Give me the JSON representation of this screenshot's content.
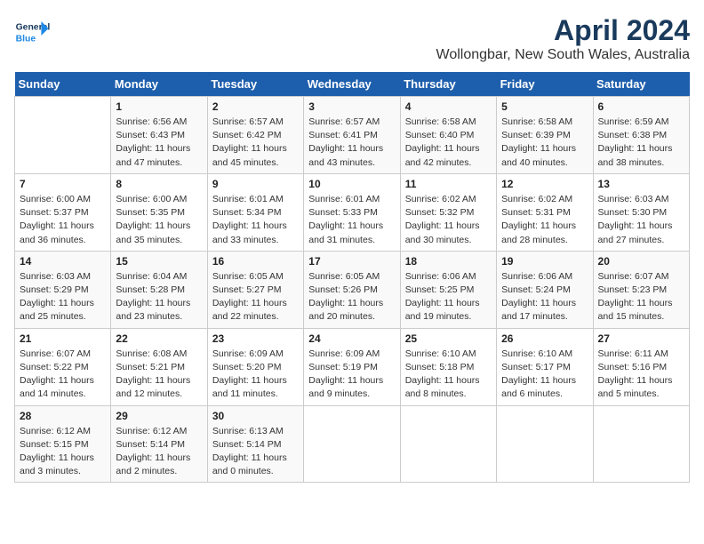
{
  "header": {
    "logo_text_general": "General",
    "logo_text_blue": "Blue",
    "month_year": "April 2024",
    "location": "Wollongbar, New South Wales, Australia"
  },
  "days_of_week": [
    "Sunday",
    "Monday",
    "Tuesday",
    "Wednesday",
    "Thursday",
    "Friday",
    "Saturday"
  ],
  "weeks": [
    [
      {
        "day": "",
        "info": ""
      },
      {
        "day": "1",
        "info": "Sunrise: 6:56 AM\nSunset: 6:43 PM\nDaylight: 11 hours\nand 47 minutes."
      },
      {
        "day": "2",
        "info": "Sunrise: 6:57 AM\nSunset: 6:42 PM\nDaylight: 11 hours\nand 45 minutes."
      },
      {
        "day": "3",
        "info": "Sunrise: 6:57 AM\nSunset: 6:41 PM\nDaylight: 11 hours\nand 43 minutes."
      },
      {
        "day": "4",
        "info": "Sunrise: 6:58 AM\nSunset: 6:40 PM\nDaylight: 11 hours\nand 42 minutes."
      },
      {
        "day": "5",
        "info": "Sunrise: 6:58 AM\nSunset: 6:39 PM\nDaylight: 11 hours\nand 40 minutes."
      },
      {
        "day": "6",
        "info": "Sunrise: 6:59 AM\nSunset: 6:38 PM\nDaylight: 11 hours\nand 38 minutes."
      }
    ],
    [
      {
        "day": "7",
        "info": "Sunrise: 6:00 AM\nSunset: 5:37 PM\nDaylight: 11 hours\nand 36 minutes."
      },
      {
        "day": "8",
        "info": "Sunrise: 6:00 AM\nSunset: 5:35 PM\nDaylight: 11 hours\nand 35 minutes."
      },
      {
        "day": "9",
        "info": "Sunrise: 6:01 AM\nSunset: 5:34 PM\nDaylight: 11 hours\nand 33 minutes."
      },
      {
        "day": "10",
        "info": "Sunrise: 6:01 AM\nSunset: 5:33 PM\nDaylight: 11 hours\nand 31 minutes."
      },
      {
        "day": "11",
        "info": "Sunrise: 6:02 AM\nSunset: 5:32 PM\nDaylight: 11 hours\nand 30 minutes."
      },
      {
        "day": "12",
        "info": "Sunrise: 6:02 AM\nSunset: 5:31 PM\nDaylight: 11 hours\nand 28 minutes."
      },
      {
        "day": "13",
        "info": "Sunrise: 6:03 AM\nSunset: 5:30 PM\nDaylight: 11 hours\nand 27 minutes."
      }
    ],
    [
      {
        "day": "14",
        "info": "Sunrise: 6:03 AM\nSunset: 5:29 PM\nDaylight: 11 hours\nand 25 minutes."
      },
      {
        "day": "15",
        "info": "Sunrise: 6:04 AM\nSunset: 5:28 PM\nDaylight: 11 hours\nand 23 minutes."
      },
      {
        "day": "16",
        "info": "Sunrise: 6:05 AM\nSunset: 5:27 PM\nDaylight: 11 hours\nand 22 minutes."
      },
      {
        "day": "17",
        "info": "Sunrise: 6:05 AM\nSunset: 5:26 PM\nDaylight: 11 hours\nand 20 minutes."
      },
      {
        "day": "18",
        "info": "Sunrise: 6:06 AM\nSunset: 5:25 PM\nDaylight: 11 hours\nand 19 minutes."
      },
      {
        "day": "19",
        "info": "Sunrise: 6:06 AM\nSunset: 5:24 PM\nDaylight: 11 hours\nand 17 minutes."
      },
      {
        "day": "20",
        "info": "Sunrise: 6:07 AM\nSunset: 5:23 PM\nDaylight: 11 hours\nand 15 minutes."
      }
    ],
    [
      {
        "day": "21",
        "info": "Sunrise: 6:07 AM\nSunset: 5:22 PM\nDaylight: 11 hours\nand 14 minutes."
      },
      {
        "day": "22",
        "info": "Sunrise: 6:08 AM\nSunset: 5:21 PM\nDaylight: 11 hours\nand 12 minutes."
      },
      {
        "day": "23",
        "info": "Sunrise: 6:09 AM\nSunset: 5:20 PM\nDaylight: 11 hours\nand 11 minutes."
      },
      {
        "day": "24",
        "info": "Sunrise: 6:09 AM\nSunset: 5:19 PM\nDaylight: 11 hours\nand 9 minutes."
      },
      {
        "day": "25",
        "info": "Sunrise: 6:10 AM\nSunset: 5:18 PM\nDaylight: 11 hours\nand 8 minutes."
      },
      {
        "day": "26",
        "info": "Sunrise: 6:10 AM\nSunset: 5:17 PM\nDaylight: 11 hours\nand 6 minutes."
      },
      {
        "day": "27",
        "info": "Sunrise: 6:11 AM\nSunset: 5:16 PM\nDaylight: 11 hours\nand 5 minutes."
      }
    ],
    [
      {
        "day": "28",
        "info": "Sunrise: 6:12 AM\nSunset: 5:15 PM\nDaylight: 11 hours\nand 3 minutes."
      },
      {
        "day": "29",
        "info": "Sunrise: 6:12 AM\nSunset: 5:14 PM\nDaylight: 11 hours\nand 2 minutes."
      },
      {
        "day": "30",
        "info": "Sunrise: 6:13 AM\nSunset: 5:14 PM\nDaylight: 11 hours\nand 0 minutes."
      },
      {
        "day": "",
        "info": ""
      },
      {
        "day": "",
        "info": ""
      },
      {
        "day": "",
        "info": ""
      },
      {
        "day": "",
        "info": ""
      }
    ]
  ]
}
